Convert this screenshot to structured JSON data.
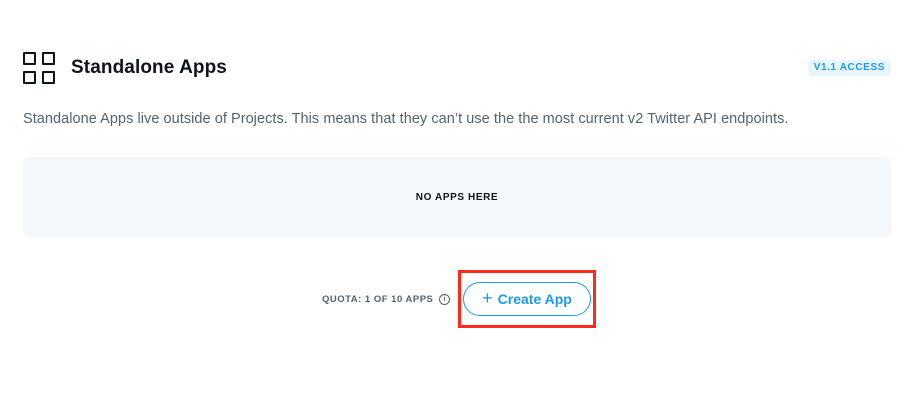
{
  "section": {
    "title": "Standalone Apps",
    "badge": "V1.1 ACCESS",
    "description": "Standalone Apps live outside of Projects. This means that they can’t use the the most current v2 Twitter API endpoints."
  },
  "apps_panel": {
    "empty_message": "NO APPS HERE"
  },
  "footer": {
    "quota_label": "QUOTA: 1 OF 10 APPS",
    "info_glyph": "i",
    "create_button": {
      "plus_glyph": "+",
      "label": "Create App"
    }
  },
  "colors": {
    "accent": "#1d9bf0",
    "highlight": "#ff2a1a",
    "panel_bg": "#f5f8fa",
    "text_primary": "#0f1419",
    "text_secondary": "#536471"
  }
}
